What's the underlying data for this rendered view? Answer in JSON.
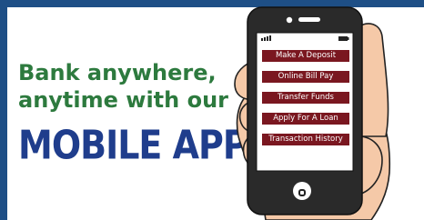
{
  "colors": {
    "border": "#1e4f86",
    "headline_green": "#2d7a3e",
    "headline_blue": "#1f3d8c",
    "button_bg": "#7a1720",
    "phone_body": "#2a2a2a",
    "skin": "#f5c9a8"
  },
  "headline": {
    "line1": "Bank anywhere,",
    "line2": "anytime with our",
    "line3": "MOBILE APP"
  },
  "phone": {
    "menu": [
      {
        "label": "Make A Deposit",
        "icon": ""
      },
      {
        "label": "Online Bill Pay",
        "icon": ""
      },
      {
        "label": "Transfer Funds",
        "icon": ""
      },
      {
        "label": "Apply For A Loan",
        "icon": ""
      },
      {
        "label": "Transaction History",
        "icon": ""
      }
    ],
    "icons": {
      "signal": "signal-bars-icon",
      "battery": "battery-icon",
      "camera": "camera-icon",
      "speaker": "speaker-icon",
      "home": "home-button-icon"
    }
  }
}
